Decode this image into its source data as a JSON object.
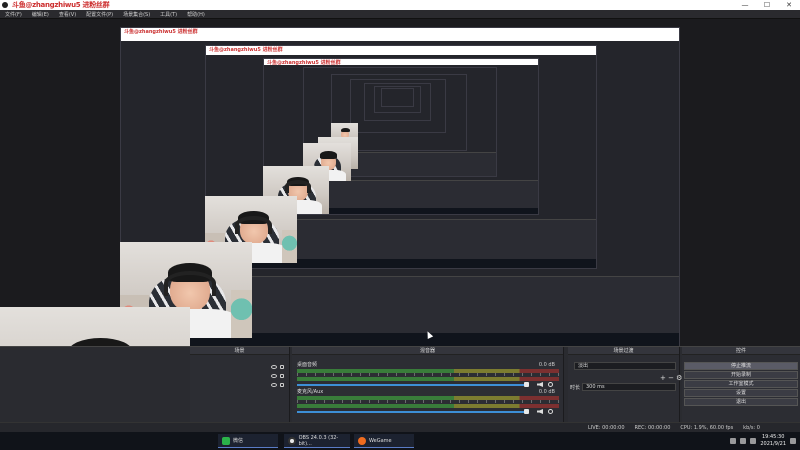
{
  "window": {
    "title": "斗鱼@zhangzhiwu5 进粉丝群",
    "controls": [
      "—",
      "☐",
      "✕"
    ]
  },
  "menu": [
    "文件(F)",
    "编辑(E)",
    "查看(V)",
    "配置文件(P)",
    "场景集合(S)",
    "工具(T)",
    "帮助(H)"
  ],
  "nested_titles": [
    "斗鱼@zhangzhiwu5 进粉丝群",
    "斗鱼@zhangzhiwu5 进粉丝群",
    "斗鱼@zhangzhiwu5 进粉丝群"
  ],
  "docks": {
    "scenes_title": "场景",
    "mixer_title": "混音器",
    "transitions_title": "场景过渡",
    "controls_title": "控件"
  },
  "mixer": {
    "tracks": [
      {
        "label": "桌面音频",
        "db": "0.0 dB"
      },
      {
        "label": "麦克风/Aux",
        "db": "0.0 dB"
      }
    ]
  },
  "transitions": {
    "type": "淡出",
    "duration_label": "时长",
    "duration_value": "300 ms"
  },
  "controls": {
    "buttons": [
      "停止推流",
      "开始录制",
      "工作室模式",
      "设置",
      "退出"
    ]
  },
  "status": {
    "live": "LIVE: 00:00:00",
    "rec": "REC: 00:00:00",
    "cpu": "CPU: 1.9%, 60.00 fps",
    "bitrate": "kb/s: 0"
  },
  "taskbar": {
    "items": [
      "微信",
      "OBS 24.0.3 (32-bit)...",
      "WeGame"
    ],
    "time": "19:45:30",
    "date": "2021/9/21"
  }
}
